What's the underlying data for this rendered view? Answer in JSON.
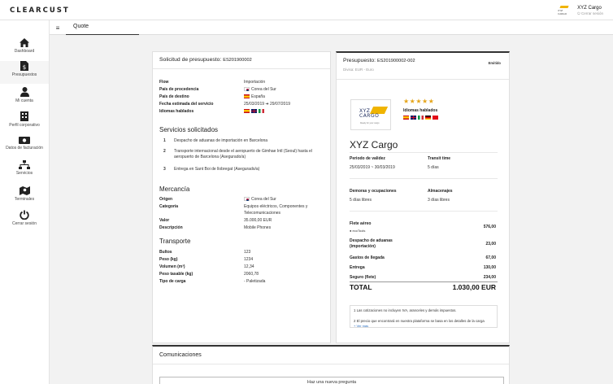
{
  "app": {
    "logo": "CLEARCUST"
  },
  "user": {
    "name": "XYZ Cargo",
    "logout": "Cerrar sesión",
    "logo_text": "XYZ CARGO"
  },
  "sidebar": {
    "items": [
      {
        "label": "Dashboard",
        "icon": "home-icon"
      },
      {
        "label": "Presupuestos",
        "icon": "document-dollar-icon",
        "active": true
      },
      {
        "label": "Mi cuenta",
        "icon": "user-icon"
      },
      {
        "label": "Perfil corporativo",
        "icon": "building-icon"
      },
      {
        "label": "Datos de facturación",
        "icon": "banknote-icon"
      },
      {
        "label": "Servicios",
        "icon": "network-icon"
      },
      {
        "label": "Terminales",
        "icon": "map-pin-icon"
      },
      {
        "label": "Cerrar sesión",
        "icon": "power-icon"
      }
    ]
  },
  "subbar": {
    "tab": "Quote",
    "menu_icon": "≡"
  },
  "request": {
    "title": "Solicitud de presupuesto:",
    "code": "ES201900002",
    "details": [
      {
        "k": "Flow",
        "v": "Importación"
      },
      {
        "k": "País de procedencia",
        "v": "Corea del Sur",
        "flag": "kr"
      },
      {
        "k": "País de destino",
        "v": "España",
        "flag": "es"
      },
      {
        "k": "Fecha estimada del servicio",
        "v": "25/03/2019 ➜ 29/07/2019"
      },
      {
        "k": "Idiomas hablados",
        "v": ""
      }
    ],
    "services_title": "Servicios solicitados",
    "services": [
      {
        "n": "1",
        "text": "Despacho de aduanas de importación en Barcelona"
      },
      {
        "n": "2",
        "text": "Transporte internacional desde el aeropuerto de Gimhae Intl (Seoul) hasta el aeropuerto de Barcelona (Asegurado/a)"
      },
      {
        "n": "3",
        "text": "Entrega en Sant Boi de llobregat (Asegurado/a)"
      }
    ],
    "goods_title": "Mercancía",
    "goods": [
      {
        "k": "Origen",
        "v": "Corea del Sur"
      },
      {
        "k": "Categoría",
        "v": "Equipos eléctricos, Componentes y Telecomunicaciones"
      },
      {
        "k": "Valor",
        "v": "35.000,00 EUR"
      },
      {
        "k": "Descripción",
        "v": "Mobile Phones"
      }
    ],
    "transport_title": "Transporte",
    "transport": [
      {
        "k": "Bultos",
        "v": "123"
      },
      {
        "k": "Peso (kg)",
        "v": "1234"
      },
      {
        "k": "Volumen (m³)",
        "v": "12,34"
      },
      {
        "k": "Peso tasable (kg)",
        "v": "2060,78"
      },
      {
        "k": "Tipo de carga",
        "v": "- Paletizada"
      }
    ]
  },
  "quote": {
    "title": "Presupuesto:",
    "code": "ES201900002-002",
    "currency": "Divisa: EUR - Euro",
    "status": "Emitido",
    "rating": "★★★★★",
    "languages_label": "Idiomas hablados",
    "provider": "XYZ Cargo",
    "logo_tagline": "Ready for your cargo",
    "validity_label": "Periodo de validez",
    "validity_value": "25/03/2019 ~ 30/03/2019",
    "transit_label": "Transit time",
    "transit_value": "5 días",
    "demurrage_label": "Demoras y ocupaciones",
    "demurrage_value": "5 días libres",
    "storage_label": "Almacenajes",
    "storage_value": "3 días libres",
    "lines": [
      {
        "label": "Flete aéreo",
        "sub": "ecoTools",
        "value": "576,00"
      },
      {
        "label": "Despacho de aduanas (importación)",
        "value": "23,00"
      },
      {
        "label": "Gastos de llegada",
        "value": "67,00"
      },
      {
        "label": "Entrega",
        "value": "130,00"
      },
      {
        "label": "Seguro (flete)",
        "value": "234,00"
      }
    ],
    "total_label": "TOTAL",
    "total_value": "1.030,00 EUR",
    "notes": [
      "1   Las cotizaciones no incluyen IVA, aranceles y demás impuestos.",
      "2   El precio que encontrará en nuestra plataforma se basa en los detalles de la carga"
    ],
    "more": "+ Ver más"
  },
  "communications": {
    "title": "Comunicaciones",
    "ask_button": "Haz una nueva pregunta"
  }
}
